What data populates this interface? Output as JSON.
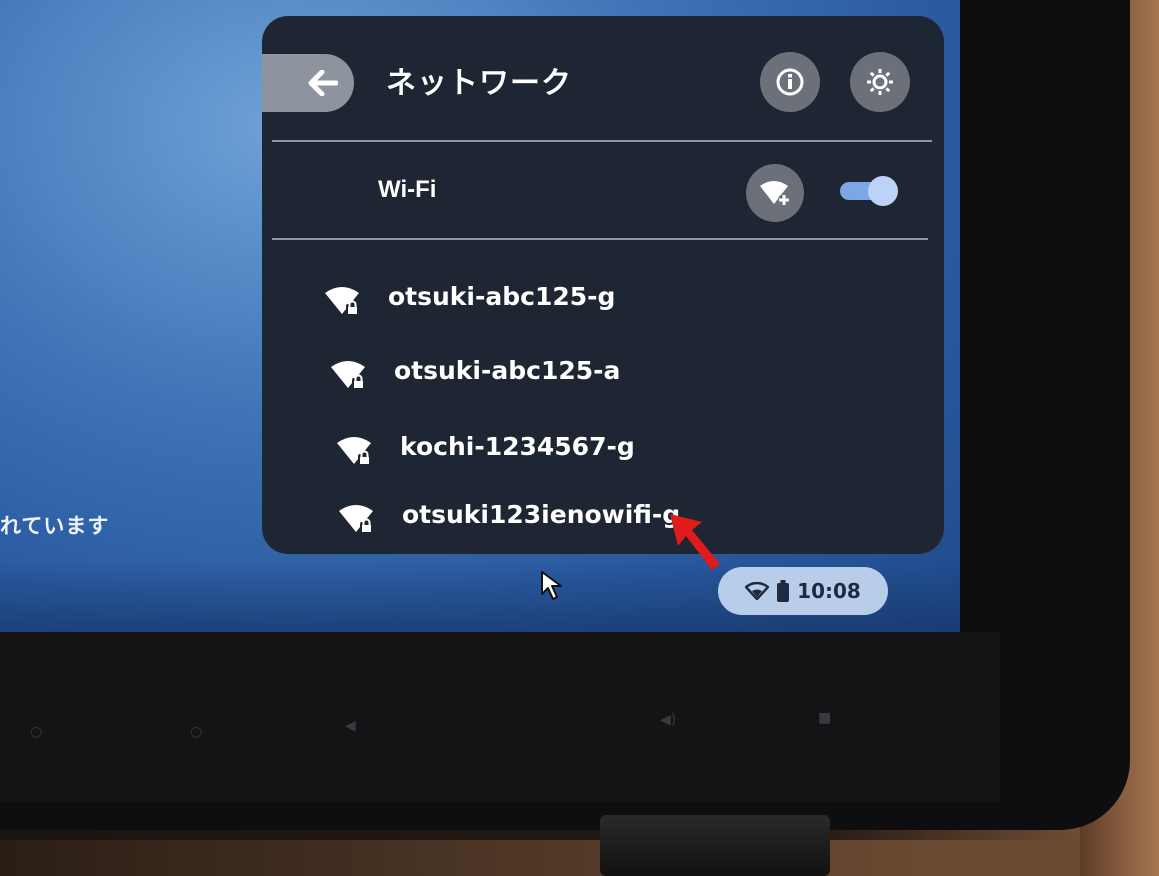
{
  "panel": {
    "title": "ネットワーク",
    "back_icon": "arrow-left-icon",
    "info_icon": "info-icon",
    "settings_icon": "gear-icon"
  },
  "wifi": {
    "label": "Wi-Fi",
    "add_icon": "wifi-add-icon",
    "toggle_on": true
  },
  "networks": [
    {
      "name": "otsuki-abc125-g",
      "icon": "wifi-lock-icon"
    },
    {
      "name": "otsuki-abc125-a",
      "icon": "wifi-lock-icon"
    },
    {
      "name": "kochi-1234567-g",
      "icon": "wifi-lock-icon"
    },
    {
      "name": "otsuki123ienowifi-g",
      "icon": "wifi-lock-icon"
    }
  ],
  "background_text": "れています",
  "tray": {
    "time": "10:08",
    "wifi_icon": "wifi-icon",
    "battery_icon": "battery-icon"
  },
  "colors": {
    "panel_bg": "#1f2633",
    "toggle_accent": "#7ea6e6",
    "tray_bg": "#b8cde9",
    "annotation_arrow": "#e01b1b"
  }
}
